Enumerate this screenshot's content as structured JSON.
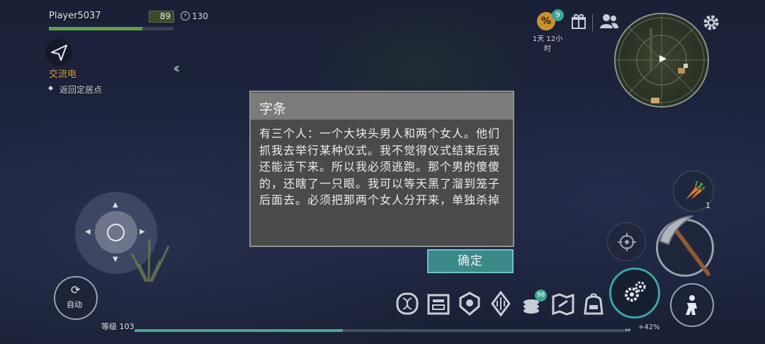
{
  "player": {
    "name": "Player5037",
    "health": "89",
    "health_percent": 75,
    "energy": "130"
  },
  "quest": {
    "title": "交流电",
    "subtitle": "返回定居点"
  },
  "top_right": {
    "discount_badge": "9",
    "discount_symbol": "%",
    "time_text": "1天 12小时"
  },
  "dialog": {
    "title": "字条",
    "body": "有三个人：一个大块头男人和两个女人。他们抓我去举行某种仪式。我不觉得仪式结束后我还能活下来。所以我必须逃跑。那个男的傻傻的，还瞎了一只眼。我可以等天黑了溜到笼子后面去。必须把那两个女人分开来，单独杀掉",
    "confirm_label": "确定"
  },
  "controls": {
    "auto_label": "自动",
    "carrot_count": "1"
  },
  "bottom_bar": {
    "inventory_badge": "98",
    "level_label": "等级 103",
    "xp_percent_text": "+42%",
    "xp_progress": 0.42
  },
  "icons": [
    "quest-arrow-icon",
    "energy-icon",
    "discount-icon",
    "gift-icon",
    "friends-icon",
    "settings-icon",
    "minimap",
    "auto-icon",
    "carrot-icon",
    "aim-icon",
    "pickaxe-icon",
    "build-gears-icon",
    "crouch-icon",
    "dna-icon",
    "crafting-icon",
    "clan-icon",
    "skill-icon",
    "coins-icon",
    "map-icon",
    "backpack-icon"
  ],
  "colors": {
    "accent_teal": "#3aa596",
    "quest_gold": "#d9a441",
    "health_green": "#5fa04a"
  }
}
